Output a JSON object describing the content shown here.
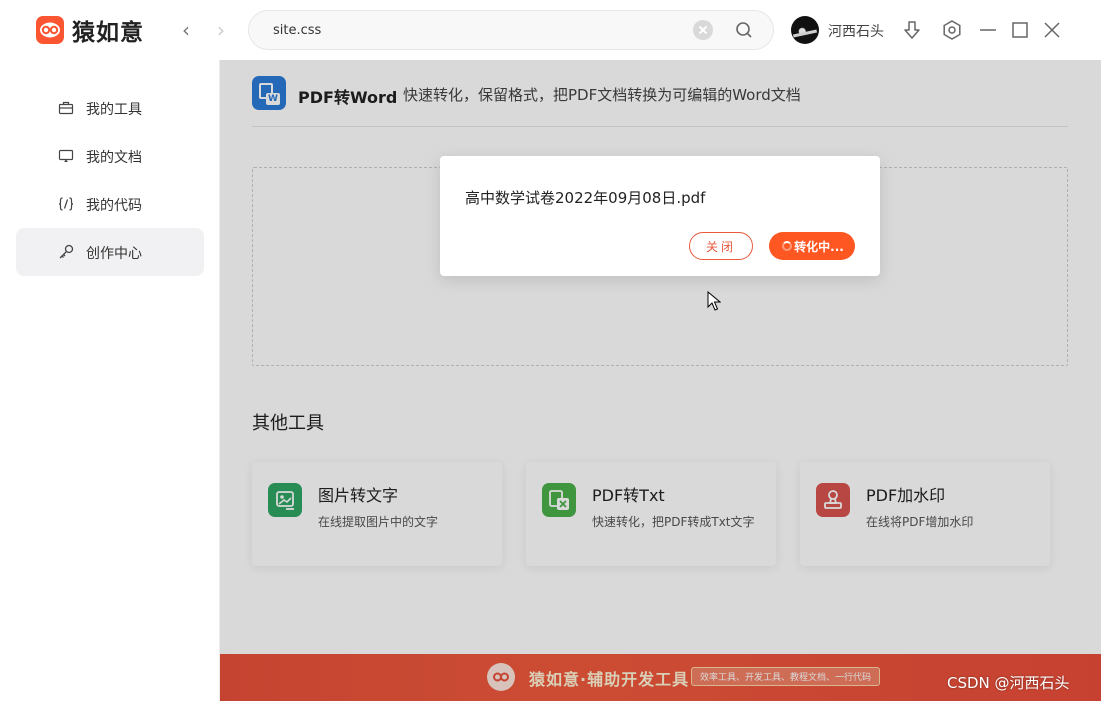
{
  "app": {
    "title": "猿如意"
  },
  "search": {
    "value": "site.css",
    "placeholder": ""
  },
  "user": {
    "name": "河西石头"
  },
  "sidebar": {
    "items": [
      {
        "label": "我的工具",
        "icon": "briefcase-icon"
      },
      {
        "label": "我的文档",
        "icon": "monitor-icon"
      },
      {
        "label": "我的代码",
        "icon": "code-braces-icon"
      },
      {
        "label": "创作中心",
        "icon": "key-icon",
        "active": true
      }
    ]
  },
  "tool": {
    "title": "PDF转Word",
    "description": "快速转化，保留格式，把PDF文档转换为可编辑的Word文档",
    "icon_color": "#2b7bd9"
  },
  "other_tools": {
    "heading": "其他工具",
    "cards": [
      {
        "title": "图片转文字",
        "description": "在线提取图片中的文字",
        "icon": "image-text-icon",
        "color": "#2fa564"
      },
      {
        "title": "PDF转Txt",
        "description": "快速转化，把PDF转成Txt文字",
        "icon": "file-x-icon",
        "color": "#4cb04a"
      },
      {
        "title": "PDF加水印",
        "description": "在线将PDF增加水印",
        "icon": "stamp-icon",
        "color": "#d9534f"
      }
    ]
  },
  "banner": {
    "title": "猿如意·辅助开发工具",
    "tagline": "效率工具、开发工具、教程文档、一行代码"
  },
  "dialog": {
    "filename": "高中数学试卷2022年09月08日.pdf",
    "close_label": "关闭",
    "status_label": "转化中..."
  },
  "watermark": "CSDN @河西石头",
  "colors": {
    "accent": "#ff5722",
    "brand": "#fb5531"
  }
}
